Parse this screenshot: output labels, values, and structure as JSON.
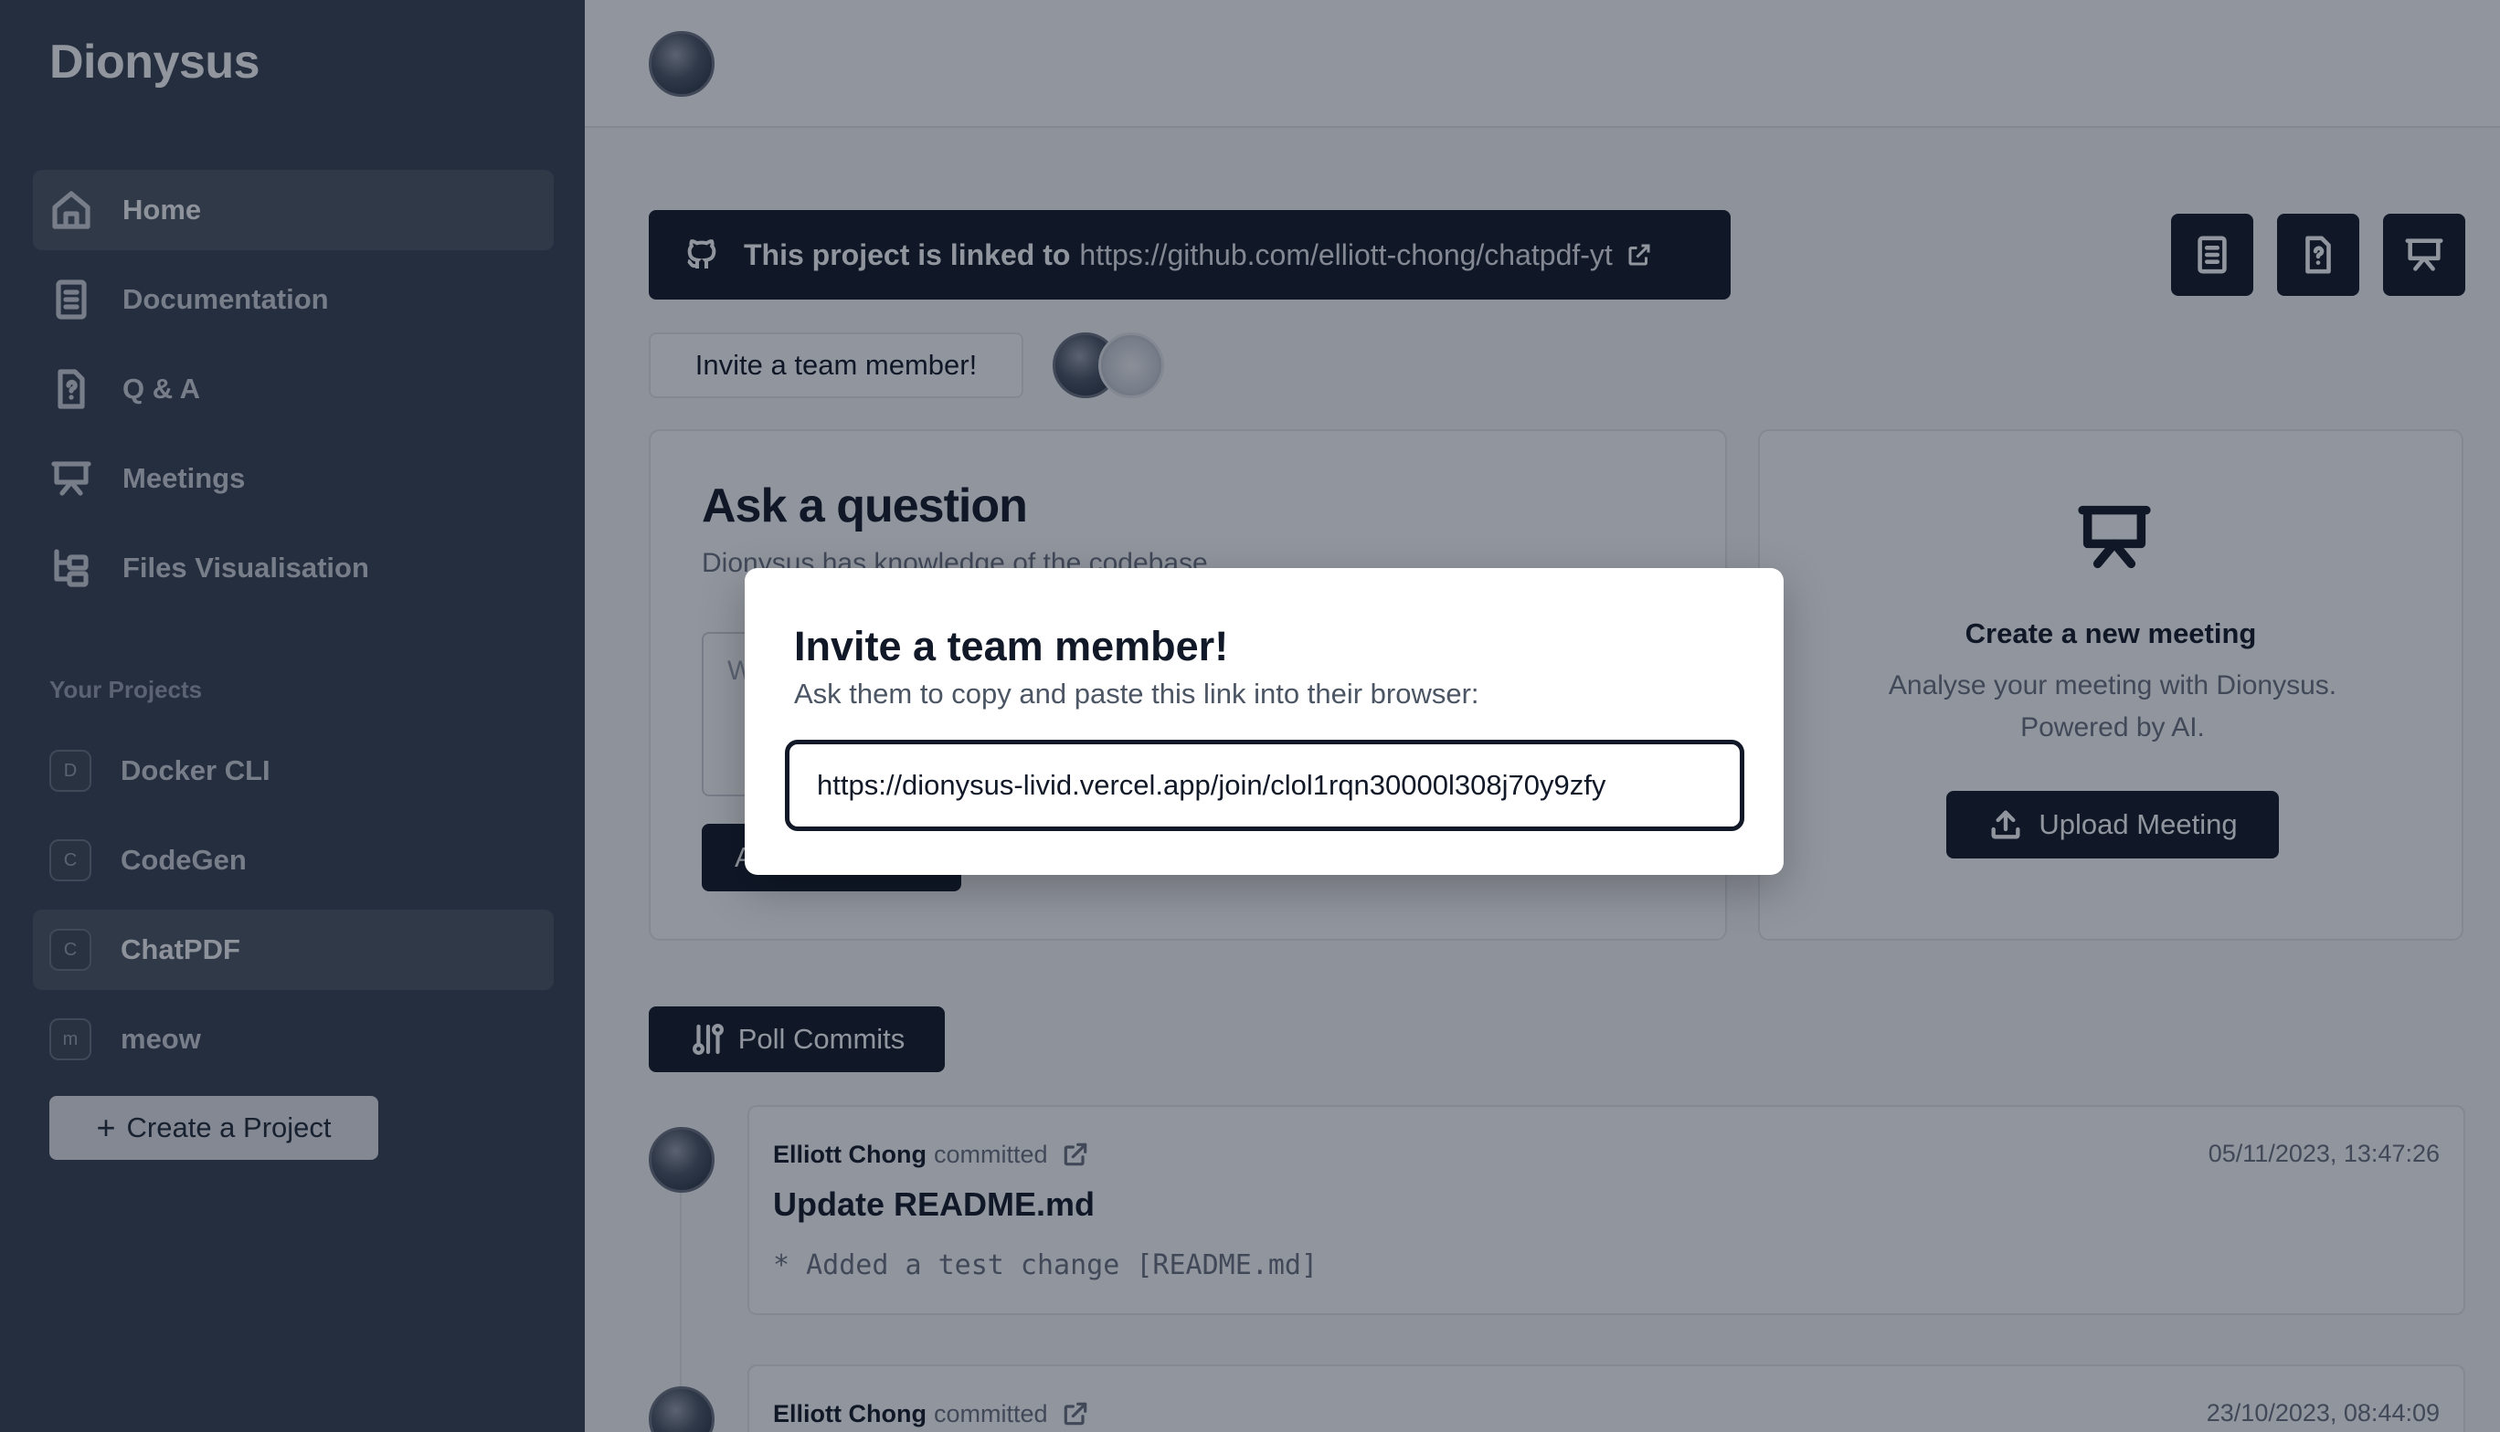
{
  "sidebar": {
    "brand": "Dionysus",
    "nav": [
      {
        "label": "Home",
        "icon": "home-icon",
        "active": true
      },
      {
        "label": "Documentation",
        "icon": "document-icon",
        "active": false
      },
      {
        "label": "Q & A",
        "icon": "question-file-icon",
        "active": false
      },
      {
        "label": "Meetings",
        "icon": "presentation-icon",
        "active": false
      },
      {
        "label": "Files Visualisation",
        "icon": "folder-tree-icon",
        "active": false
      }
    ],
    "projects_title": "Your Projects",
    "projects": [
      {
        "initial": "D",
        "label": "Docker CLI",
        "active": false
      },
      {
        "initial": "C",
        "label": "CodeGen",
        "active": false
      },
      {
        "initial": "C",
        "label": "ChatPDF",
        "active": true
      },
      {
        "initial": "m",
        "label": "meow",
        "active": false
      }
    ],
    "create_project": "Create a Project"
  },
  "main": {
    "github_banner": {
      "text": "This project is linked to",
      "link": "https://github.com/elliott-chong/chatpdf-yt"
    },
    "invite_button": "Invite a team member!",
    "ask_card": {
      "title": "Ask a question",
      "subtitle": "Dionysus has knowledge of the codebase",
      "textarea_placeholder": "W",
      "button": "A"
    },
    "meeting_card": {
      "title": "Create a new meeting",
      "subtitle": "Analyse your meeting with Dionysus. Powered by AI.",
      "button": "Upload Meeting"
    },
    "poll_button": "Poll Commits",
    "commits": [
      {
        "author": "Elliott Chong",
        "verb": "committed",
        "date": "05/11/2023, 13:47:26",
        "title": "Update README.md",
        "body": "* Added a test change [README.md]"
      },
      {
        "author": "Elliott Chong",
        "verb": "committed",
        "date": "23/10/2023, 08:44:09",
        "title": "",
        "body": ""
      }
    ]
  },
  "modal": {
    "title": "Invite a team member!",
    "subtitle": "Ask them to copy and paste this link into their browser:",
    "link": "https://dionysus-livid.vercel.app/join/clol1rqn30000l308j70y9zfy"
  },
  "colors": {
    "sidebar_bg": "#374151",
    "primary": "#111827",
    "overlay": "rgba(15,23,42,0.46)"
  }
}
